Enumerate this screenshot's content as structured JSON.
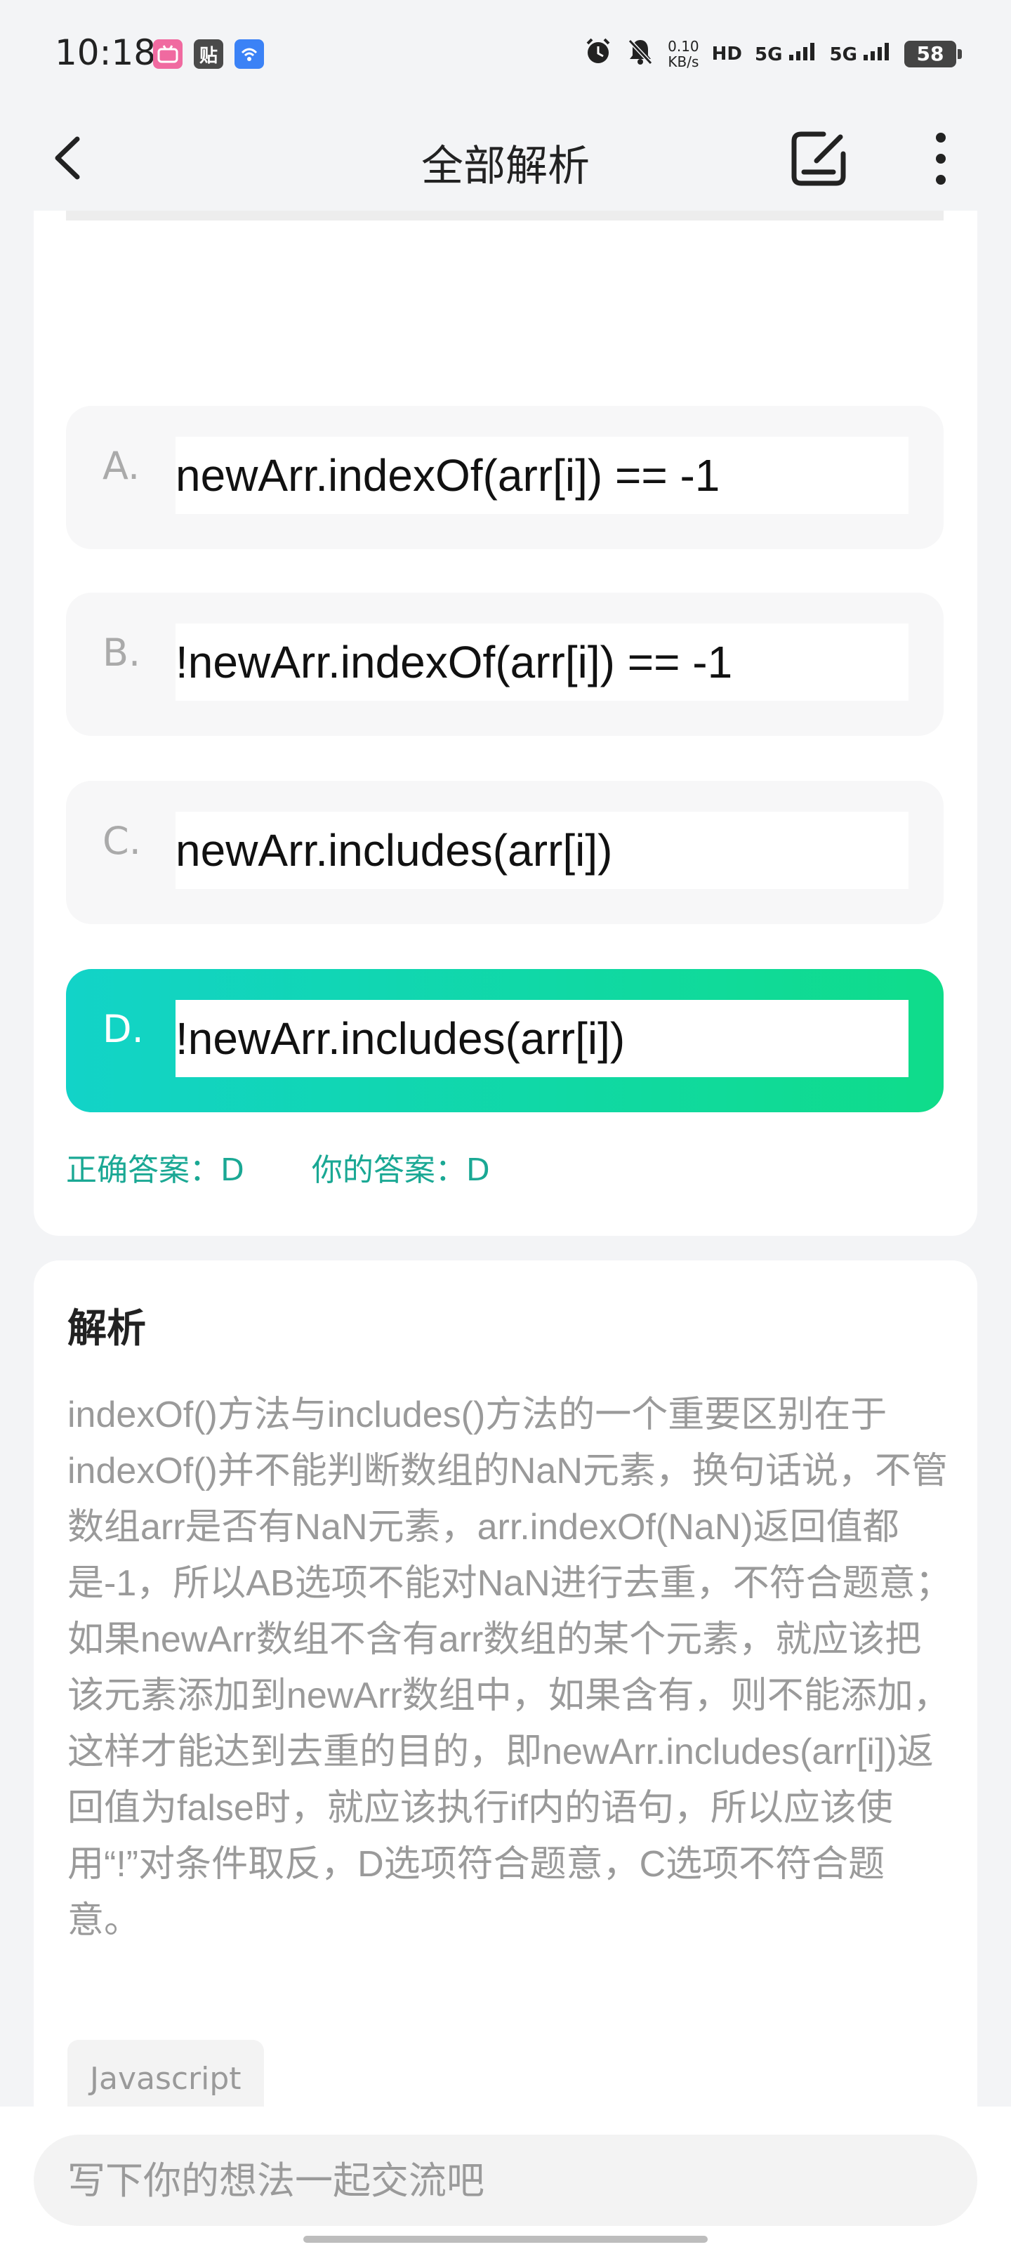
{
  "status_bar": {
    "time": "10:18",
    "app_icon_2": "贴",
    "net_speed_value": "0.10",
    "net_speed_unit": "KB/s",
    "hd_label": "HD",
    "signal_1": "5G",
    "signal_2": "5G",
    "battery": "58"
  },
  "header": {
    "title": "全部解析"
  },
  "question": {
    "options": [
      {
        "letter": "A.",
        "text": "newArr.indexOf(arr[i]) == -1"
      },
      {
        "letter": "B.",
        "text": "!newArr.indexOf(arr[i]) == -1"
      },
      {
        "letter": "C.",
        "text": "newArr.includes(arr[i])"
      },
      {
        "letter": "D.",
        "text": "!newArr.includes(arr[i])"
      }
    ],
    "correct_answer": "正确答案：D",
    "your_answer": "你的答案：D"
  },
  "analysis": {
    "title": "解析",
    "body": "indexOf()方法与includes()方法的一个重要区别在于indexOf()并不能判断数组的NaN元素，换句话说，不管数组arr是否有NaN元素，arr.indexOf(NaN)返回值都是-1，所以AB选项不能对NaN进行去重，不符合题意；如果newArr数组不含有arr数组的某个元素，就应该把该元素添加到newArr数组中，如果含有，则不能添加，这样才能达到去重的目的，即newArr.includes(arr[i])返回值为false时，就应该执行if内的语句，所以应该使用“!”对条件取反，D选项符合题意，C选项不符合题意。",
    "tag": "Javascript"
  },
  "comment": {
    "placeholder": "写下你的想法一起交流吧"
  },
  "colors": {
    "accent_start": "#12d3c8",
    "accent_end": "#0fdc8a",
    "answer_text": "#1aa894",
    "muted_text": "#9a9a9a"
  }
}
